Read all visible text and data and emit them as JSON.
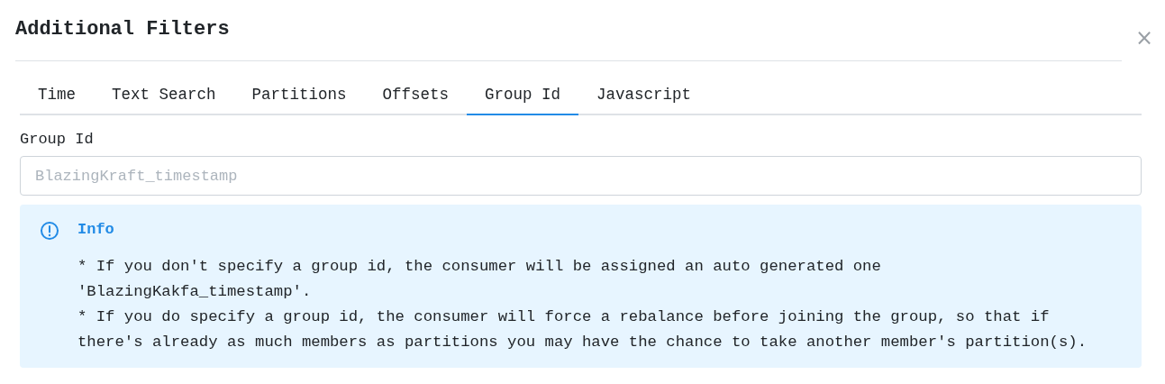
{
  "dialog": {
    "title": "Additional Filters",
    "close": "×"
  },
  "tabs": [
    {
      "label": "Time",
      "selected": false
    },
    {
      "label": "Text Search",
      "selected": false
    },
    {
      "label": "Partitions",
      "selected": false
    },
    {
      "label": "Offsets",
      "selected": false
    },
    {
      "label": "Group Id",
      "selected": true
    },
    {
      "label": "Javascript",
      "selected": false
    }
  ],
  "field": {
    "label": "Group Id",
    "placeholder": "BlazingKraft_timestamp"
  },
  "info": {
    "title": "Info",
    "lines": [
      "* If you don't specify a group id, the consumer will be assigned an auto generated one",
      "'BlazingKakfa_timestamp'.",
      "* If you do specify a group id, the consumer will force a rebalance before joining the group, so that if",
      "there's already as much members as partitions you may have the chance to take another member's partition(s)."
    ]
  }
}
